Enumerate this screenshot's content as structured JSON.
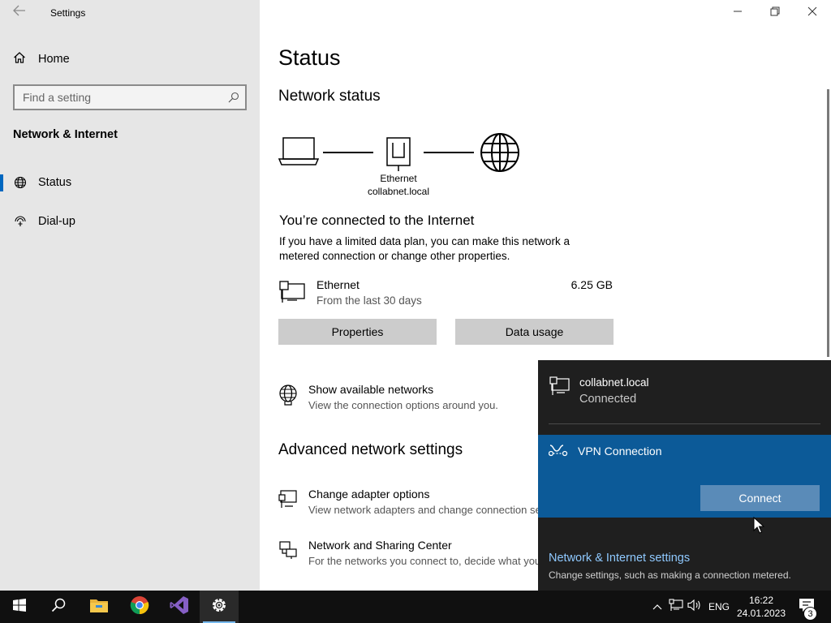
{
  "window": {
    "title": "Settings"
  },
  "sidebar": {
    "home_label": "Home",
    "search_placeholder": "Find a setting",
    "section_title": "Network & Internet",
    "items": [
      {
        "label": "Status",
        "icon": "globe-icon",
        "active": true
      },
      {
        "label": "Dial-up",
        "icon": "dialup-icon",
        "active": false
      }
    ]
  },
  "main": {
    "title": "Status",
    "network_status_heading": "Network status",
    "diagram": {
      "adapter_label": "Ethernet",
      "network_label": "collabnet.local"
    },
    "connected_heading": "You’re connected to the Internet",
    "connected_desc": "If you have a limited data plan, you can make this network a metered connection or change other properties.",
    "ethernet": {
      "name": "Ethernet",
      "sub": "From the last 30 days",
      "usage": "6.25 GB"
    },
    "buttons": {
      "properties": "Properties",
      "data_usage": "Data usage"
    },
    "show_networks": {
      "title": "Show available networks",
      "desc": "View the connection options around you."
    },
    "advanced_heading": "Advanced network settings",
    "change_adapter": {
      "title": "Change adapter options",
      "desc": "View network adapters and change connection se"
    },
    "sharing_center": {
      "title": "Network and Sharing Center",
      "desc": "For the networks you connect to, decide what you"
    }
  },
  "flyout": {
    "network": {
      "name": "collabnet.local",
      "status": "Connected"
    },
    "vpn": {
      "name": "VPN Connection",
      "connect_label": "Connect"
    },
    "settings_link": "Network & Internet settings",
    "settings_desc": "Change settings, such as making a connection metered."
  },
  "taskbar": {
    "apps": [
      "start-icon",
      "search-icon",
      "file-explorer-icon",
      "chrome-icon",
      "visual-studio-icon",
      "settings-gear-icon"
    ],
    "lang": "ENG",
    "time": "16:22",
    "date": "24.01.2023",
    "notification_count": "3"
  },
  "colors": {
    "accent": "#0067c0",
    "vpn_highlight": "#0c5a98",
    "flyout_bg": "#1f1f1f",
    "link": "#8fc9ff"
  }
}
